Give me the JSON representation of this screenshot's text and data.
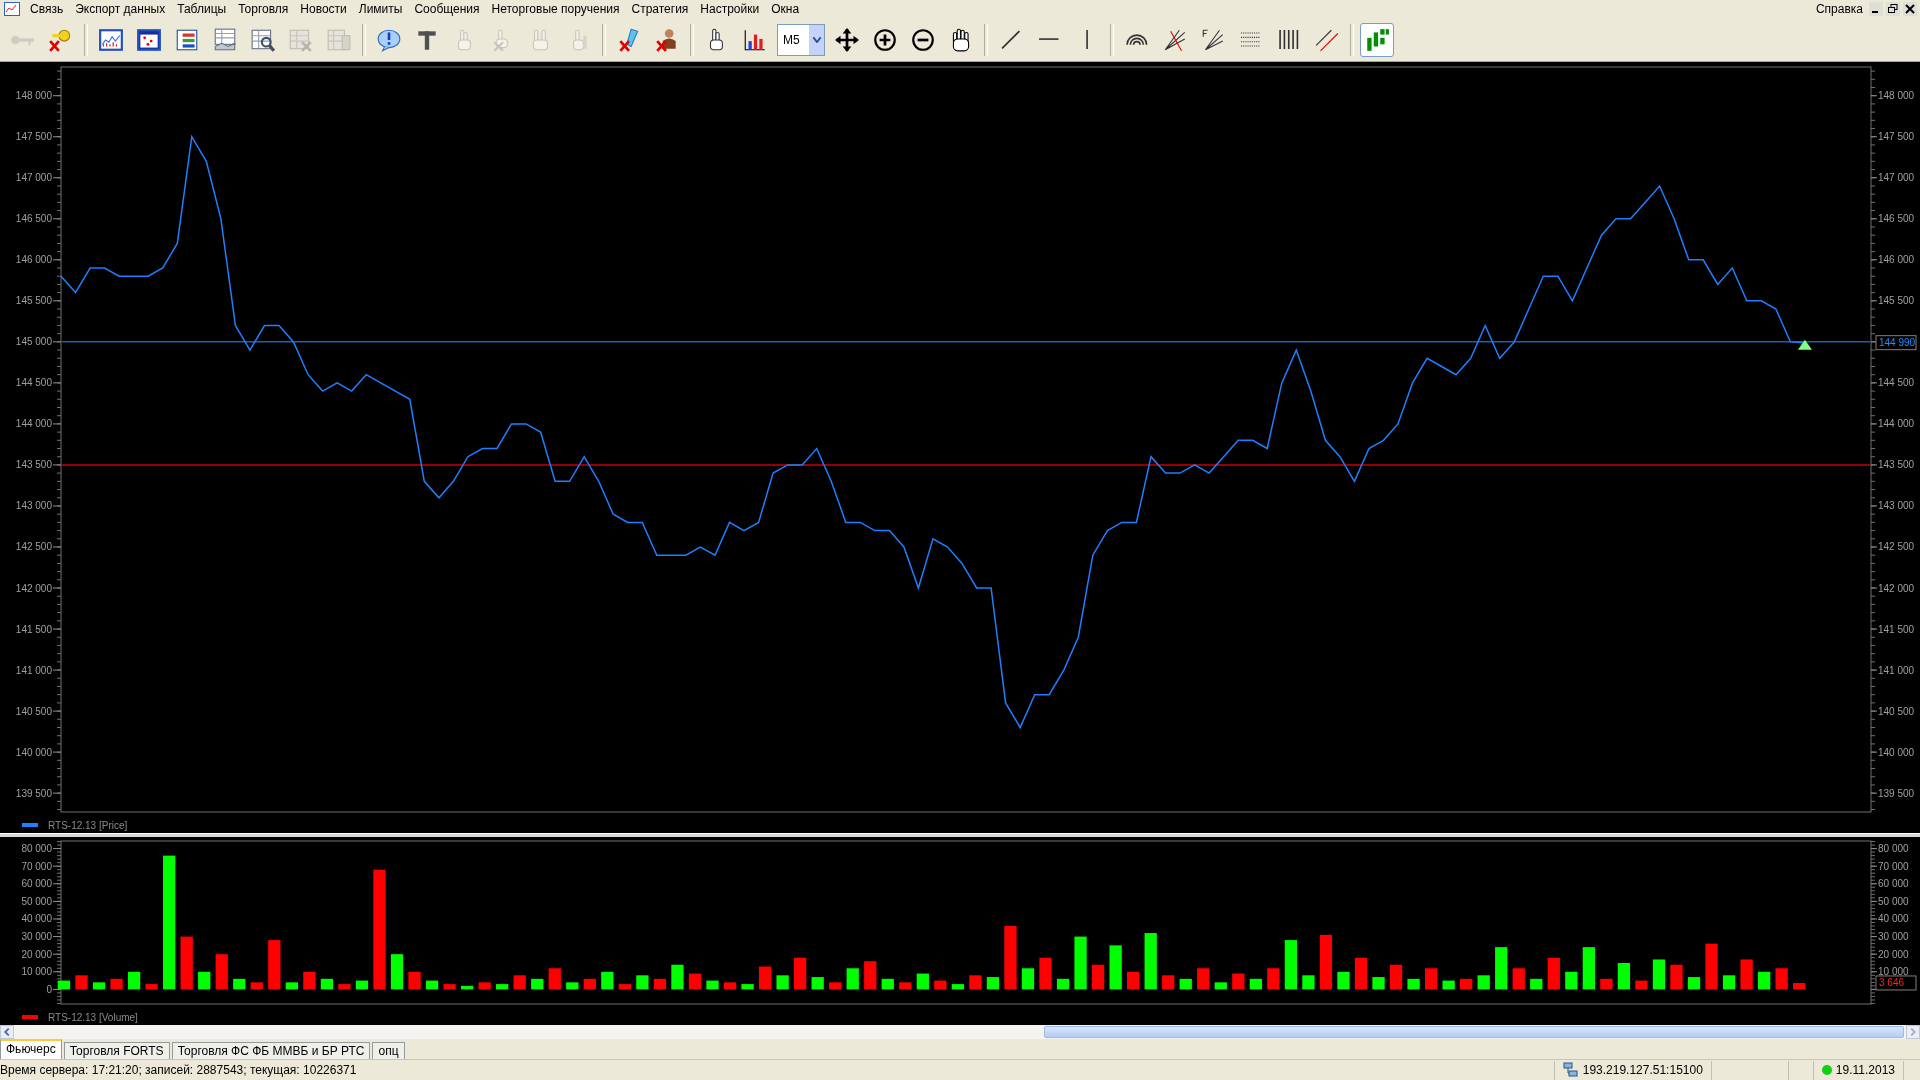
{
  "menu": {
    "items": [
      "Связь",
      "Экспорт данных",
      "Таблицы",
      "Торговля",
      "Новости",
      "Лимиты",
      "Сообщения",
      "Неторговые поручения",
      "Стратегия",
      "Настройки",
      "Окна"
    ],
    "right_item": "Справка"
  },
  "toolbar": {
    "groups": [
      [
        {
          "kind": "button",
          "disabled": true,
          "pressed": false
        },
        {
          "kind": "button",
          "disabled": false,
          "pressed": false
        }
      ],
      [
        {
          "kind": "button",
          "disabled": false,
          "pressed": false
        },
        {
          "kind": "button",
          "disabled": false,
          "pressed": false
        },
        {
          "kind": "button",
          "disabled": false,
          "pressed": false
        },
        {
          "kind": "button",
          "disabled": false,
          "pressed": false
        },
        {
          "kind": "button",
          "disabled": false,
          "pressed": false
        },
        {
          "kind": "button",
          "disabled": true,
          "pressed": false
        },
        {
          "kind": "button",
          "disabled": true,
          "pressed": false
        }
      ],
      [
        {
          "kind": "button",
          "disabled": false,
          "pressed": false
        },
        {
          "kind": "button",
          "disabled": false,
          "pressed": false
        },
        {
          "kind": "button",
          "disabled": true,
          "pressed": false
        },
        {
          "kind": "button",
          "disabled": true,
          "pressed": false
        },
        {
          "kind": "button",
          "disabled": true,
          "pressed": false
        },
        {
          "kind": "button",
          "disabled": true,
          "pressed": false
        }
      ],
      [
        {
          "kind": "button",
          "disabled": false,
          "pressed": false
        },
        {
          "kind": "button",
          "disabled": false,
          "pressed": false
        }
      ],
      [
        {
          "kind": "button",
          "disabled": false,
          "pressed": false
        },
        {
          "kind": "button",
          "disabled": false,
          "pressed": false
        },
        {
          "kind": "dropdown",
          "value": "M5"
        },
        {
          "kind": "button",
          "disabled": false,
          "pressed": false
        },
        {
          "kind": "button",
          "disabled": false,
          "pressed": false
        },
        {
          "kind": "button",
          "disabled": false,
          "pressed": false
        },
        {
          "kind": "button",
          "disabled": false,
          "pressed": false
        }
      ],
      [
        {
          "kind": "button",
          "disabled": false,
          "pressed": false
        },
        {
          "kind": "button",
          "disabled": false,
          "pressed": false
        },
        {
          "kind": "button",
          "disabled": false,
          "pressed": false
        }
      ],
      [
        {
          "kind": "button",
          "disabled": false,
          "pressed": false
        },
        {
          "kind": "button",
          "disabled": false,
          "pressed": false
        },
        {
          "kind": "button",
          "disabled": false,
          "pressed": false
        },
        {
          "kind": "button",
          "disabled": false,
          "pressed": false
        },
        {
          "kind": "button",
          "disabled": false,
          "pressed": false
        },
        {
          "kind": "button",
          "disabled": false,
          "pressed": false
        }
      ],
      [
        {
          "kind": "button",
          "disabled": false,
          "pressed": true
        }
      ]
    ]
  },
  "price_pane": {
    "right_axis_labels": [
      "148 000",
      "147 500",
      "147 000",
      "146 500",
      "146 000",
      "145 500",
      "144 500",
      "144 000",
      "143 500",
      "143 000",
      "142 500",
      "142 000",
      "141 500",
      "141 000",
      "140 500",
      "140 000",
      "139 500"
    ],
    "current_value": {
      "label": "144 990",
      "color": "#1e90ff"
    },
    "last_marker": {
      "color": "#80ff80"
    },
    "chart_data": {
      "type": "line",
      "ylim": [
        139270,
        148350
      ],
      "categories": [
        null,
        null,
        null,
        null,
        null,
        null,
        null,
        null,
        null,
        null,
        null,
        null,
        null,
        null,
        null,
        null,
        null,
        null,
        null,
        null,
        null,
        null,
        null,
        null,
        null,
        null,
        null,
        null,
        null,
        null,
        null,
        null,
        null,
        null,
        null,
        null,
        null,
        null,
        null,
        null,
        null,
        null,
        null,
        null,
        null,
        null,
        null,
        null,
        null,
        null,
        null,
        null,
        null,
        null,
        null,
        null,
        null,
        null,
        null,
        null,
        null,
        null,
        null,
        null,
        null,
        null,
        null,
        null,
        null,
        null,
        null,
        null,
        null,
        null,
        null,
        null,
        null,
        null,
        null,
        null,
        null,
        null,
        null,
        null,
        null,
        null,
        null,
        null,
        null,
        null,
        null,
        null,
        null,
        null,
        null,
        null,
        null,
        null,
        null,
        null,
        null,
        null,
        null,
        null,
        null,
        null,
        null,
        null,
        null,
        null,
        null,
        null,
        null,
        null,
        null,
        null,
        null,
        null,
        null,
        null,
        null
      ],
      "yticks": [
        {
          "value": 148000,
          "label": "148 000"
        },
        {
          "value": 147500,
          "label": "147 500"
        },
        {
          "value": 147000,
          "label": "147 000"
        },
        {
          "value": 146500,
          "label": "146 500"
        },
        {
          "value": 146000,
          "label": "146 000"
        },
        {
          "value": 145500,
          "label": "145 500"
        },
        {
          "value": 145000,
          "label": "145 000"
        },
        {
          "value": 144500,
          "label": "144 500"
        },
        {
          "value": 144000,
          "label": "144 000"
        },
        {
          "value": 143500,
          "label": "143 500"
        },
        {
          "value": 143000,
          "label": "143 000"
        },
        {
          "value": 142500,
          "label": "142 500"
        },
        {
          "value": 142000,
          "label": "142 000"
        },
        {
          "value": 141500,
          "label": "141 500"
        },
        {
          "value": 141000,
          "label": "141 000"
        },
        {
          "value": 140500,
          "label": "140 500"
        },
        {
          "value": 140000,
          "label": "140 000"
        },
        {
          "value": 139500,
          "label": "139 500"
        }
      ],
      "series": [
        {
          "name": "RTS-12.13 [Price]",
          "color": "#1e7fff",
          "values": [
            145800,
            145600,
            145900,
            145900,
            145800,
            145800,
            145800,
            145900,
            146200,
            147500,
            147200,
            146500,
            145200,
            144900,
            145200,
            145200,
            145000,
            144600,
            144400,
            144500,
            144400,
            144600,
            144500,
            144400,
            144300,
            143300,
            143100,
            143300,
            143600,
            143700,
            143700,
            144000,
            144000,
            143900,
            143300,
            143300,
            143600,
            143300,
            142900,
            142800,
            142800,
            142400,
            142400,
            142400,
            142500,
            142400,
            142800,
            142700,
            142800,
            143400,
            143500,
            143500,
            143700,
            143300,
            142800,
            142800,
            142700,
            142700,
            142500,
            142000,
            142600,
            142500,
            142300,
            142000,
            142000,
            140600,
            140300,
            140700,
            140700,
            141000,
            141400,
            142400,
            142700,
            142800,
            142800,
            143600,
            143400,
            143400,
            143500,
            143400,
            143600,
            143800,
            143800,
            143700,
            144500,
            144900,
            144400,
            143800,
            143600,
            143300,
            143700,
            143800,
            144000,
            144500,
            144800,
            144700,
            144600,
            144800,
            145200,
            144800,
            145000,
            145400,
            145800,
            145800,
            145500,
            145900,
            146300,
            146500,
            146500,
            146700,
            146900,
            146500,
            146000,
            146000,
            145700,
            145900,
            145500,
            145500,
            145400,
            145000,
            144990
          ]
        }
      ],
      "ref_lines": [
        {
          "axis": "y",
          "value": 145000,
          "color": "#1d5fb0"
        },
        {
          "axis": "y",
          "value": 143500,
          "color": "#c80000"
        }
      ]
    }
  },
  "volume_pane": {
    "legend": {
      "label": "RTS-12.13 [Volume]",
      "color": "#ff0000"
    },
    "right_axis_labels": [
      "80 000",
      "70 000",
      "60 000",
      "50 000",
      "40 000",
      "30 000",
      "20 000",
      "10 000"
    ],
    "current_value": {
      "label": "3 646",
      "color": "#ff2020"
    },
    "chart_data": {
      "type": "bar",
      "stacked": true,
      "ylim": [
        -8300,
        84300
      ],
      "categories": [
        null,
        null,
        null,
        null,
        null,
        null,
        null,
        null,
        null,
        null,
        null,
        null,
        null,
        null,
        null,
        null,
        null,
        null,
        null,
        null,
        null,
        null,
        null,
        null,
        null,
        null,
        null,
        null,
        null,
        null,
        null,
        null,
        null,
        null,
        null,
        null,
        null,
        null,
        null,
        null,
        null,
        null,
        null,
        null,
        null,
        null,
        null,
        null,
        null,
        null,
        null,
        null,
        null,
        null,
        null,
        null,
        null,
        null,
        null,
        null,
        null,
        null,
        null,
        null,
        null,
        null,
        null,
        null,
        null,
        null,
        null,
        null,
        null,
        null,
        null,
        null,
        null,
        null,
        null,
        null,
        null,
        null,
        null,
        null,
        null,
        null,
        null,
        null,
        null,
        null,
        null,
        null,
        null,
        null,
        null,
        null,
        null,
        null,
        null,
        null
      ],
      "yticks": [
        {
          "value": 80000,
          "label": "80 000"
        },
        {
          "value": 70000,
          "label": "70 000"
        },
        {
          "value": 60000,
          "label": "60 000"
        },
        {
          "value": 50000,
          "label": "50 000"
        },
        {
          "value": 40000,
          "label": "40 000"
        },
        {
          "value": 30000,
          "label": "30 000"
        },
        {
          "value": 20000,
          "label": "20 000"
        },
        {
          "value": 10000,
          "label": "10 000"
        },
        {
          "value": 0,
          "label": "0"
        }
      ],
      "series": [
        {
          "color": "#00ff00",
          "values": [
            5000,
            0,
            4000,
            0,
            10000,
            0,
            76000,
            0,
            10000,
            0,
            6000,
            0,
            0,
            4000,
            0,
            6000,
            0,
            5000,
            0,
            20000,
            0,
            5000,
            0,
            2000,
            0,
            3000,
            0,
            6000,
            0,
            4000,
            0,
            10000,
            0,
            8000,
            0,
            14000,
            0,
            5000,
            0,
            3000,
            0,
            8000,
            0,
            7000,
            0,
            12000,
            0,
            6000,
            0,
            9000,
            0,
            3000,
            0,
            7000,
            0,
            12000,
            0,
            6000,
            30000,
            0,
            25000,
            0,
            32000,
            0,
            6000,
            0,
            4000,
            0,
            6000,
            0,
            28000,
            8000,
            0,
            10000,
            0,
            7000,
            0,
            6000,
            0,
            5000,
            0,
            8000,
            24000,
            0,
            6000,
            0,
            10000,
            24000,
            0,
            15000,
            0,
            17000,
            0,
            7000,
            0,
            8000,
            0,
            10000,
            0,
            0
          ]
        },
        {
          "color": "#ff0000",
          "values": [
            0,
            8000,
            0,
            6000,
            0,
            3000,
            0,
            30000,
            0,
            20000,
            0,
            4000,
            28000,
            0,
            10000,
            0,
            3000,
            0,
            68000,
            0,
            10000,
            0,
            3000,
            0,
            4000,
            0,
            8000,
            0,
            12000,
            0,
            6000,
            0,
            3000,
            0,
            6000,
            0,
            9000,
            0,
            4000,
            0,
            13000,
            0,
            18000,
            0,
            4000,
            0,
            16000,
            0,
            4000,
            0,
            5000,
            0,
            8000,
            0,
            36000,
            0,
            18000,
            0,
            0,
            14000,
            0,
            10000,
            0,
            8000,
            0,
            12000,
            0,
            9000,
            0,
            12000,
            0,
            0,
            31000,
            0,
            18000,
            0,
            14000,
            0,
            12000,
            0,
            6000,
            0,
            0,
            12000,
            0,
            18000,
            0,
            0,
            6000,
            0,
            5000,
            0,
            14000,
            0,
            26000,
            0,
            17000,
            0,
            12000,
            3646
          ]
        }
      ]
    }
  },
  "tabs": [
    {
      "label": "Фьючерс",
      "selected": true
    },
    {
      "label": "Торговля FORTS",
      "selected": false
    },
    {
      "label": "Торговля ФС ФБ ММВБ и БР РТС",
      "selected": false
    },
    {
      "label": "опц",
      "selected": false
    }
  ],
  "status_bar": {
    "server_info": "Время сервера: 17:21:20; записей: 2887543; текущая: 10226371",
    "address": "193.219.127.51:15100",
    "connected": true,
    "date": "19.11.2013"
  }
}
